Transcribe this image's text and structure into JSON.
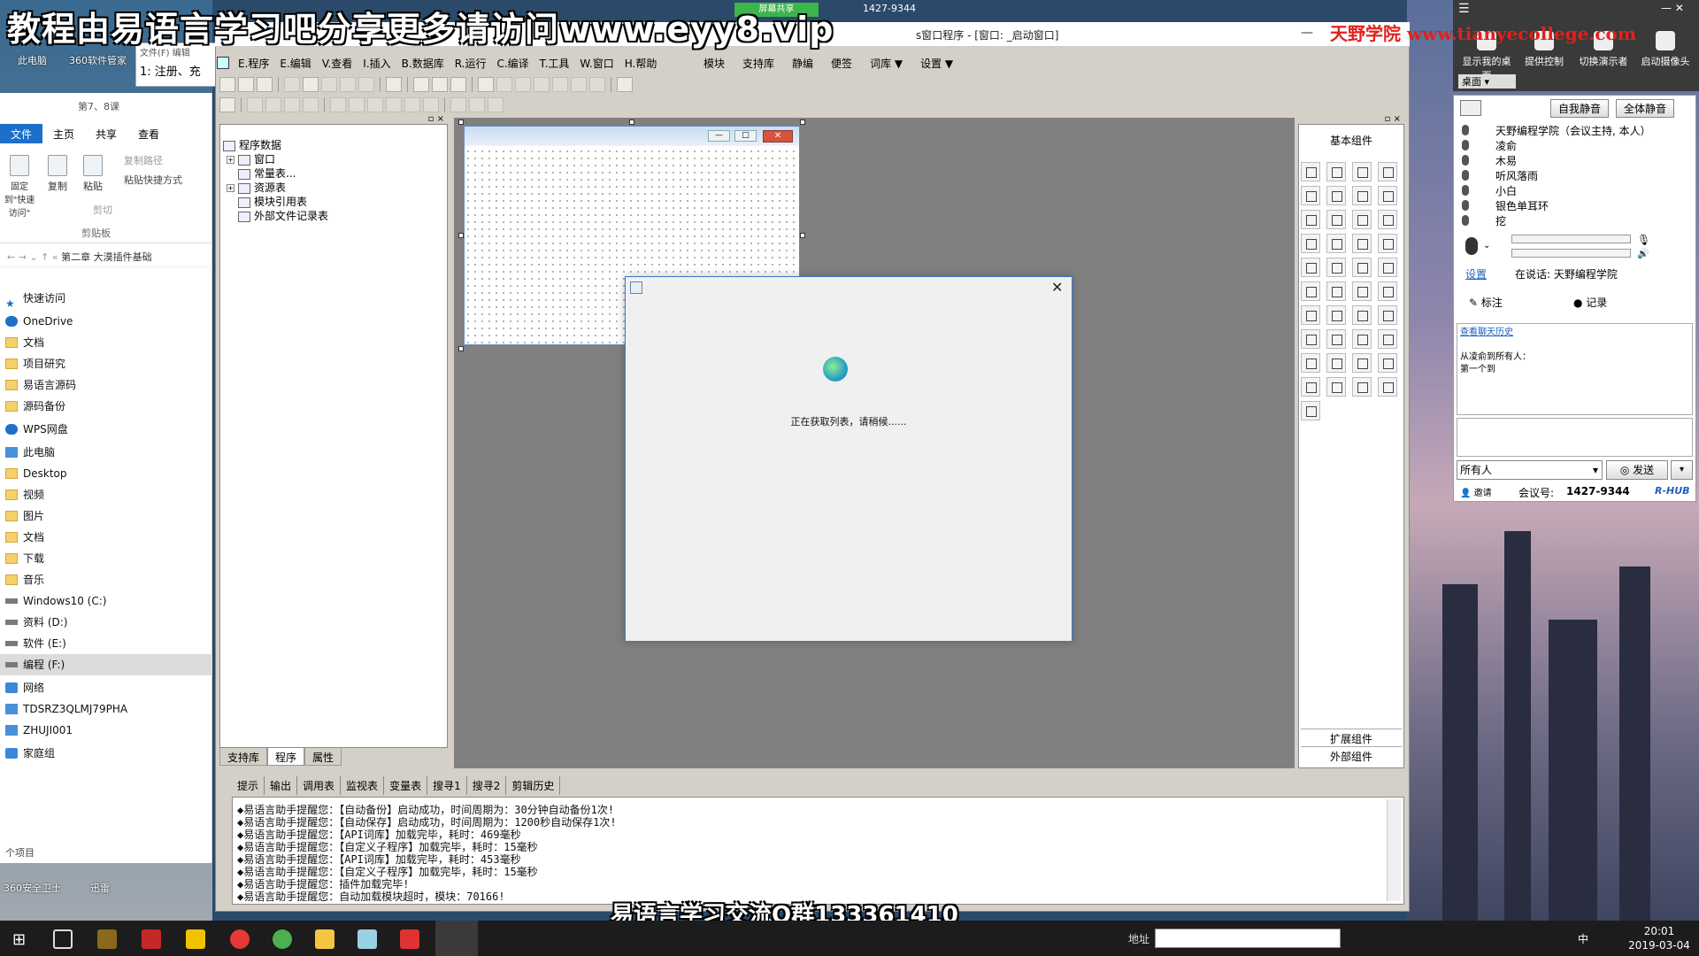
{
  "overlays": {
    "banner": "教程由易语言学习吧分享更多请访问www.eyy8.vip",
    "brand": "天野学院  www.tianyecollege.com",
    "footer": "易语言学习交流Q群133361410",
    "share_badge": "屏幕共享",
    "share_code": "1427-9344"
  },
  "desktop_icons": [
    {
      "label": "此电脑"
    },
    {
      "label": "360软件管家"
    },
    {
      "label": "360安全卫士"
    },
    {
      "label": "迅雷"
    }
  ],
  "notepad_snippet": {
    "menu": "文件(F)   编辑",
    "text": "1: 注册、充"
  },
  "explorer": {
    "title": "第7、8课",
    "tabs": [
      "文件",
      "主页",
      "共享",
      "查看"
    ],
    "ribbon": {
      "pin": "固定到\"快速访问\"",
      "copy": "复制",
      "paste": "粘贴",
      "copy_path": "复制路径",
      "paste_shortcut": "粘贴快捷方式",
      "cut": "剪切",
      "group": "剪贴板"
    },
    "address": "第二章 大漠插件基础",
    "nav": [
      {
        "label": "快速访问",
        "icon": "star-icon"
      },
      {
        "label": "OneDrive",
        "icon": "cloud-icon"
      },
      {
        "label": "文档",
        "icon": "folder-icon"
      },
      {
        "label": "项目研究",
        "icon": "folder-icon"
      },
      {
        "label": "易语言源码",
        "icon": "folder-icon"
      },
      {
        "label": "源码备份",
        "icon": "folder-icon"
      },
      {
        "label": "WPS网盘",
        "icon": "cloud-icon"
      },
      {
        "label": "此电脑",
        "icon": "pc-icon"
      },
      {
        "label": "Desktop",
        "icon": "folder-icon"
      },
      {
        "label": "视频",
        "icon": "folder-icon"
      },
      {
        "label": "图片",
        "icon": "folder-icon"
      },
      {
        "label": "文档",
        "icon": "folder-icon"
      },
      {
        "label": "下载",
        "icon": "folder-icon"
      },
      {
        "label": "音乐",
        "icon": "folder-icon"
      },
      {
        "label": "Windows10 (C:)",
        "icon": "drive-icon"
      },
      {
        "label": "资料 (D:)",
        "icon": "drive-icon"
      },
      {
        "label": "软件 (E:)",
        "icon": "drive-icon"
      },
      {
        "label": "编程 (F:)",
        "icon": "drive-icon",
        "selected": true
      },
      {
        "label": "网络",
        "icon": "network-icon"
      },
      {
        "label": "TDSRZ3QLMJ79PHA",
        "icon": "pc-icon"
      },
      {
        "label": "ZHUJI001",
        "icon": "pc-icon"
      },
      {
        "label": "家庭组",
        "icon": "network-icon"
      }
    ],
    "status": "个项目"
  },
  "ide": {
    "title": "s窗口程序 - [窗口: _启动窗口]",
    "menu": [
      "E.程序",
      "E.编辑",
      "V.查看",
      "I.插入",
      "B.数据库",
      "R.运行",
      "C.编译",
      "T.工具",
      "W.窗口",
      "H.帮助"
    ],
    "menu2": [
      "模块",
      "支持库",
      "静编",
      "便签",
      "词库 ▼",
      "设置 ▼"
    ],
    "tree": [
      {
        "label": "程序数据"
      },
      {
        "label": "窗口"
      },
      {
        "label": "常量表..."
      },
      {
        "label": "资源表"
      },
      {
        "label": "模块引用表"
      },
      {
        "label": "外部文件记录表"
      }
    ],
    "proj_tabs": [
      "支持库",
      "程序",
      "属性"
    ],
    "palette_title": "基本组件",
    "palette_ext": "扩展组件",
    "palette_ext2": "外部组件",
    "out_tabs": [
      "提示",
      "输出",
      "调用表",
      "监视表",
      "变量表",
      "搜寻1",
      "搜寻2",
      "剪辑历史"
    ],
    "output_lines": [
      "◆易语言助手提醒您：【自动备份】启动成功，时间周期为：30分钟自动备份1次!",
      "◆易语言助手提醒您：【自动保存】启动成功，时间周期为：1200秒自动保存1次!",
      "◆易语言助手提醒您：【API词库】加载完毕，耗时：469毫秒",
      "◆易语言助手提醒您：【自定义子程序】加载完毕，耗时：15毫秒",
      "◆易语言助手提醒您：【API词库】加载完毕，耗时：453毫秒",
      "◆易语言助手提醒您：【自定义子程序】加载完毕，耗时：15毫秒",
      "◆易语言助手提醒您：插件加载完毕!",
      "◆易语言助手提醒您：自动加载模块超时，模块：70166!"
    ]
  },
  "dialog": {
    "message": "正在获取列表，请稍候......"
  },
  "meeting": {
    "top_buttons": [
      "显示我的桌面",
      "提供控制",
      "切换演示者",
      "启动摄像头"
    ],
    "desktop_select": "桌面",
    "mute_self": "自我静音",
    "mute_all": "全体静音",
    "attendees": [
      "天野编程学院（会议主持, 本人）",
      "凌俞",
      "木易",
      "听风落雨",
      "小白",
      "银色单耳环",
      "挖"
    ],
    "settings": "设置",
    "speaking": "在说话: 天野编程学院",
    "mark": "标注",
    "record": "记录",
    "history_link": "查看聊天历史",
    "chat_line1": "从凌俞到所有人：",
    "chat_line2": "第一个到",
    "recipient": "所有人",
    "send": "发送",
    "invite": "邀请",
    "meeting_id_label": "会议号:",
    "meeting_id": "1427-9344",
    "brand": "R-HUB"
  },
  "taskbar": {
    "addr_label": "地址",
    "ime": "中",
    "time": "20:01",
    "date": "2019-03-04"
  }
}
